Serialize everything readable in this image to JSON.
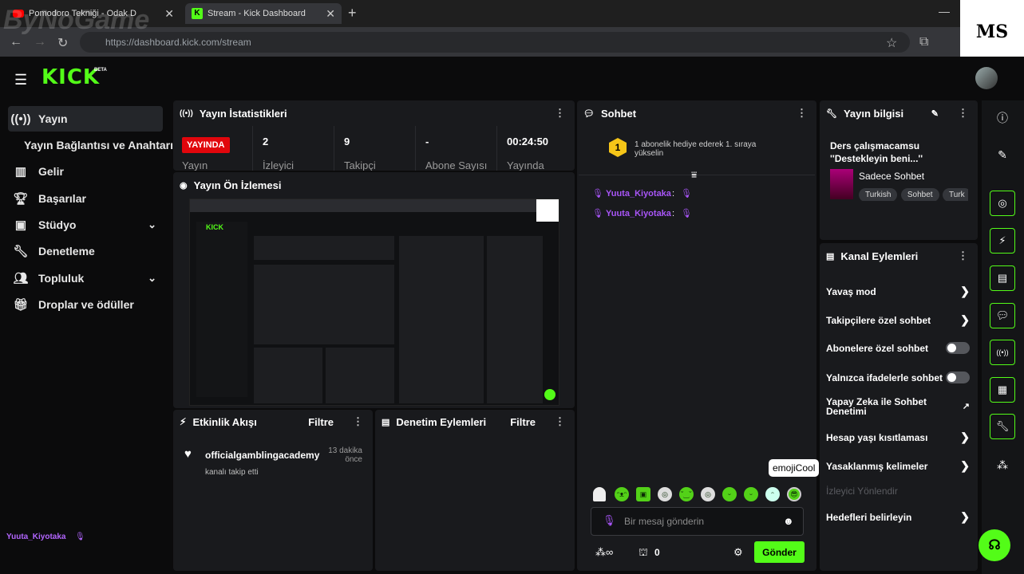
{
  "browser": {
    "tabs": [
      {
        "title": "Pomodoro Tekniği - Odak D",
        "active": false
      },
      {
        "title": "Stream - Kick Dashboard",
        "active": true
      }
    ],
    "new_tab": "+",
    "url": "https://dashboard.kick.com/stream",
    "watermark": "ByNoGame",
    "corner_logo": "MS"
  },
  "header": {
    "logo": "KICK",
    "logo_badge": "BETA"
  },
  "sidebar": {
    "items": [
      {
        "label": "Yayın",
        "icon": "broadcast-icon",
        "active": true
      },
      {
        "label": "Yayın Bağlantısı ve Anahtarı",
        "icon": "",
        "active": false
      },
      {
        "label": "Gelir",
        "icon": "bar-chart-icon",
        "active": false
      },
      {
        "label": "Başarılar",
        "icon": "trophy-icon",
        "active": false
      },
      {
        "label": "Stüdyo",
        "icon": "studio-icon",
        "active": false
      },
      {
        "label": "Denetleme",
        "icon": "wrench-icon",
        "active": false
      },
      {
        "label": "Topluluk",
        "icon": "people-icon",
        "active": false
      },
      {
        "label": "Droplar ve ödüller",
        "icon": "gift-icon",
        "active": false
      }
    ],
    "footer_user": "Yuuta_Kiyotaka"
  },
  "stats": {
    "title": "Yayın İstatistikleri",
    "live_badge": "YAYINDA",
    "first_label": "Yayın",
    "items": [
      {
        "value": "2",
        "label": "İzleyici"
      },
      {
        "value": "9",
        "label": "Takipçi"
      },
      {
        "value": "-",
        "label": "Abone Sayısı"
      },
      {
        "value": "00:24:50",
        "label": "Yayında"
      }
    ]
  },
  "preview": {
    "title": "Yayın Ön İzlemesi"
  },
  "activity": {
    "title": "Etkinlik Akışı",
    "filter": "Filtre",
    "events": [
      {
        "user": "officialgamblingacademy",
        "action": "kanalı takip etti",
        "time": "13 dakika önce"
      }
    ]
  },
  "moderation": {
    "title": "Denetim Eylemleri",
    "filter": "Filtre"
  },
  "chat": {
    "title": "Sohbet",
    "pinned": "1 abonelik hediye ederek 1. sıraya yükselin",
    "pinned_rank": "1",
    "messages": [
      {
        "user": "Yuuta_Kiyotaka",
        "sep": ":"
      },
      {
        "user": "Yuuta_Kiyotaka",
        "sep": ":"
      }
    ],
    "tooltip": "emojiCool",
    "input_placeholder": "Bir mesaj gönderin",
    "points": "0",
    "send_label": "Gönder"
  },
  "stream_info": {
    "title": "Yayın bilgisi",
    "stream_title": "Ders çalışmacamsu ''Destekleyin beni...''",
    "category": "Sadece Sohbet",
    "tags": [
      "Turkish",
      "Sohbet",
      "Turk"
    ]
  },
  "channel_actions": {
    "title": "Kanal Eylemleri",
    "items": [
      {
        "label": "Yavaş mod",
        "control": "arrow"
      },
      {
        "label": "Takipçilere özel sohbet",
        "control": "arrow"
      },
      {
        "label": "Abonelere özel sohbet",
        "control": "toggle"
      },
      {
        "label": "Yalnızca ifadelerle sohbet",
        "control": "toggle"
      },
      {
        "label": "Yapay Zeka ile Sohbet Denetimi",
        "control": "external"
      },
      {
        "label": "Hesap yaşı kısıtlaması",
        "control": "arrow"
      },
      {
        "label": "Yasaklanmış kelimeler",
        "control": "arrow"
      },
      {
        "label": "İzleyici Yönlendir",
        "control": "disabled"
      },
      {
        "label": "Hedefleri belirleyin",
        "control": "arrow"
      }
    ]
  },
  "colors": {
    "accent": "#53fc18",
    "live": "#e1060c",
    "purple": "#a855f7",
    "panel": "#191a1d"
  }
}
